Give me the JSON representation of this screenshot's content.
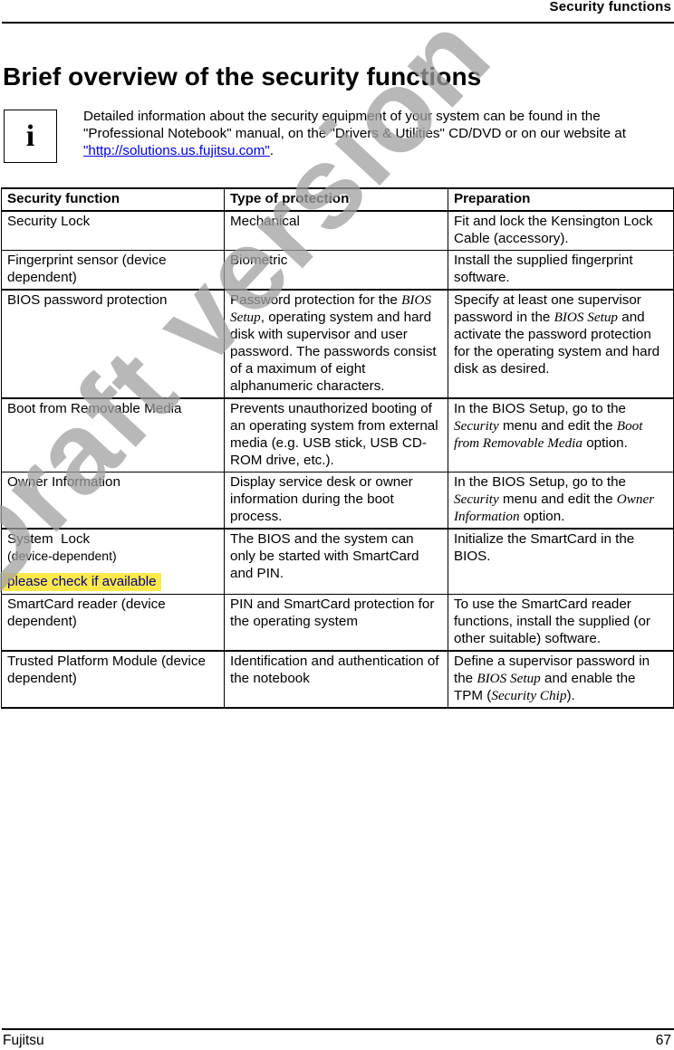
{
  "header": {
    "running_title": "Security functions"
  },
  "page_title": "Brief overview of the security functions",
  "info": {
    "icon": "info-icon",
    "icon_glyph": "i",
    "text_before_link": "Detailed information about the security equipment of your system can be found in the \"Professional Notebook\" manual, on the \"Drivers & Utilities\" CD/DVD or on our website at ",
    "link_text": "\"http://solutions.us.fujitsu.com\"",
    "text_after_link": "."
  },
  "table": {
    "headers": [
      "Security function",
      "Type of protection",
      "Preparation"
    ],
    "rows": [
      {
        "function": "Security Lock",
        "protection": "Mechanical",
        "preparation": "Fit and lock the Kensington Lock Cable (accessory)."
      },
      {
        "function": "Fingerprint sensor (device dependent)",
        "protection": "Biometric",
        "preparation": "Install the supplied fingerprint software."
      },
      {
        "function": "BIOS password protection",
        "protection_parts": [
          "Password protection for the ",
          "BIOS Setup",
          ", operating system and hard disk with supervisor and user password. The passwords consist of a maximum of eight alphanumeric characters."
        ],
        "preparation_parts": [
          "Specify at least one supervisor password in the ",
          "BIOS Setup",
          " and activate the password protection for the operating system and hard disk as desired."
        ]
      },
      {
        "function": "Boot from Removable Media",
        "protection": "Prevents unauthorized booting of an operating system from external media (e.g. USB stick, USB CD-ROM drive, etc.).",
        "preparation_parts": [
          "In the BIOS Setup, go to the ",
          "Security",
          " menu and edit the ",
          "Boot from Removable Media",
          " option."
        ]
      },
      {
        "function": "Owner Information",
        "protection": "Display service desk or owner information during the boot process.",
        "preparation_parts": [
          "In the BIOS Setup, go to the ",
          "Security",
          " menu and edit the ",
          "Owner Information",
          " option."
        ]
      },
      {
        "function": "System  Lock",
        "function_note": "(device-dependent)",
        "highlight_note": "please check if available",
        "protection": "The BIOS and the system can only be started with SmartCard and PIN.",
        "preparation": "Initialize the SmartCard in the BIOS."
      },
      {
        "function": "SmartCard reader (device dependent)",
        "protection": "PIN and SmartCard protection for the operating system",
        "preparation": "To use the SmartCard reader functions, install the supplied (or other suitable) software."
      },
      {
        "function": "Trusted Platform Module (device dependent)",
        "protection": "Identification and authentication of the notebook",
        "preparation_parts": [
          "Define a supervisor password in the ",
          "BIOS Setup",
          " and enable the TPM (",
          "Security Chip",
          ")."
        ]
      }
    ]
  },
  "watermark": "Draft version",
  "footer": {
    "left": "Fujitsu",
    "page_number": "67"
  },
  "colors": {
    "link": "#0000ee",
    "highlight_bg": "#ffe94a",
    "highlight_text": "#000080",
    "watermark": "#a0a0a0"
  }
}
